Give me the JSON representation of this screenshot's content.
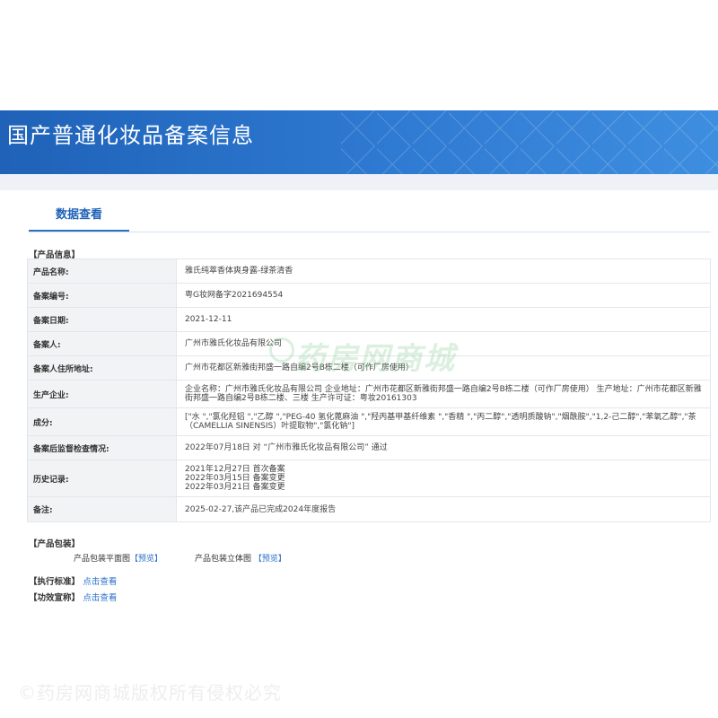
{
  "header": {
    "title": "国产普通化妆品备案信息"
  },
  "tabs": [
    {
      "label": "数据查看",
      "active": true
    }
  ],
  "product_info": {
    "section_label": "【产品信息】",
    "rows": [
      {
        "label": "产品名称:",
        "value": "雅氏纯萃香体爽身露-绿茶清香"
      },
      {
        "label": "备案编号:",
        "value": "粤G妆网备字2021694554"
      },
      {
        "label": "备案日期:",
        "value": "2021-12-11"
      },
      {
        "label": "备案人:",
        "value": "广州市雅氏化妆品有限公司"
      },
      {
        "label": "备案人住所地址:",
        "value": "广州市花都区新雅街邦盛一路自编2号B栋二楼（可作厂房使用）"
      },
      {
        "label": "生产企业:",
        "value": "企业名称：广州市雅氏化妆品有限公司 企业地址：广州市花都区新雅街邦盛一路自编2号B栋二楼（可作厂房使用） 生产地址：广州市花都区新雅街邦盛一路自编2号B栋二楼、三楼 生产许可证：粤妆20161303"
      },
      {
        "label": "成分:",
        "value": "[\"水 \",\"氯化羟铝 \",\"乙醇 \",\"PEG-40 氢化蓖麻油 \",\"羟丙基甲基纤维素 \",\"香精 \",\"丙二醇\",\"透明质酸钠\",\"烟酰胺\",\"1,2-己二醇\",\"苯氧乙醇\",\"茶（CAMELLIA SINENSIS）叶提取物\",\"氯化钠\"]"
      },
      {
        "label": "备案后监督检查情况:",
        "value": "2022年07月18日 对 “广州市雅氏化妆品有限公司” 通过"
      },
      {
        "label": "历史记录:",
        "lines": [
          "2021年12月27日 首次备案",
          "2022年03月15日 备案变更",
          "2022年03月21日 备案变更"
        ]
      },
      {
        "label": "备注:",
        "value": "2025-02-27,该产品已完成2024年度报告"
      }
    ]
  },
  "packaging": {
    "section_label": "【产品包装】",
    "flat_label": "产品包装平面图",
    "flat_link": "【预览】",
    "solid_label": "产品包装立体图",
    "solid_link": "【预览】"
  },
  "standard": {
    "section_label": "【执行标准】",
    "link": "点击查看"
  },
  "efficacy": {
    "section_label": "【功效宣称】",
    "link": "点击查看"
  },
  "watermark": {
    "text": "药房网商城",
    "copyright": "©药房网商城版权所有侵权必究"
  },
  "colors": {
    "banner": "#1f62b8",
    "accent": "#2a70c8",
    "label_bg": "#f2f3f5"
  }
}
